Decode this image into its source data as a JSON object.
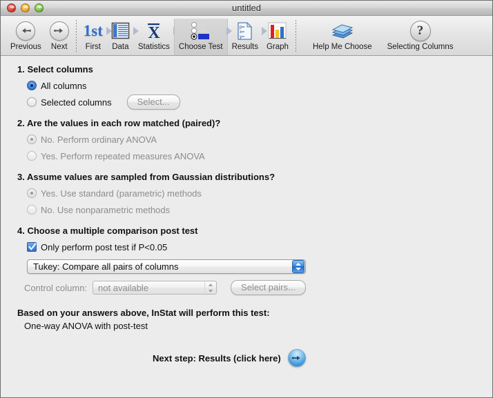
{
  "window": {
    "title": "untitled",
    "controls": [
      {
        "name": "close-button",
        "color": "#d9342a"
      },
      {
        "name": "minimize-button",
        "color": "#eba020"
      },
      {
        "name": "zoom-button",
        "color": "#71bd3a"
      }
    ]
  },
  "toolbar": {
    "items": [
      {
        "id": "previous",
        "label": "Previous",
        "icon": "arrow-left-circle-icon",
        "selected": false,
        "has_chevron": false
      },
      {
        "id": "next",
        "label": "Next",
        "icon": "arrow-right-circle-icon",
        "selected": false,
        "has_chevron": false
      },
      {
        "id": "first",
        "label": "First",
        "icon": "first-1st-icon",
        "selected": false,
        "has_chevron": true
      },
      {
        "id": "data",
        "label": "Data",
        "icon": "data-table-icon",
        "selected": false,
        "has_chevron": true
      },
      {
        "id": "statistics",
        "label": "Statistics",
        "icon": "x-bar-statistics-icon",
        "selected": false,
        "has_chevron": true
      },
      {
        "id": "choose-test",
        "label": "Choose Test",
        "icon": "choose-test-radio-icon",
        "selected": true,
        "has_chevron": true
      },
      {
        "id": "results",
        "label": "Results",
        "icon": "results-document-icon",
        "selected": false,
        "has_chevron": true
      },
      {
        "id": "graph",
        "label": "Graph",
        "icon": "bar-chart-icon",
        "selected": false,
        "has_chevron": false
      },
      {
        "id": "help-me-choose",
        "label": "Help Me Choose",
        "icon": "books-icon",
        "selected": false,
        "has_chevron": false
      },
      {
        "id": "selecting-columns",
        "label": "Selecting Columns",
        "icon": "question-mark-circle-icon",
        "selected": false,
        "has_chevron": false
      }
    ]
  },
  "sections": {
    "s1": {
      "heading": "1. Select columns",
      "options": [
        {
          "label": "All columns",
          "state": "on",
          "disabled": false
        },
        {
          "label": "Selected columns",
          "state": "off",
          "disabled": false
        }
      ],
      "select_button": "Select..."
    },
    "s2": {
      "heading": "2. Are the values in each row matched (paired)?",
      "options": [
        {
          "label": "No. Perform ordinary ANOVA",
          "state": "on",
          "disabled": true
        },
        {
          "label": "Yes. Perform repeated measures ANOVA",
          "state": "off",
          "disabled": true
        }
      ]
    },
    "s3": {
      "heading": "3. Assume values are sampled from Gaussian distributions?",
      "options": [
        {
          "label": "Yes. Use standard (parametric) methods",
          "state": "on",
          "disabled": true
        },
        {
          "label": "No. Use nonparametric methods",
          "state": "off",
          "disabled": true
        }
      ]
    },
    "s4": {
      "heading": "4. Choose a multiple comparison post test",
      "checkbox_label": "Only perform post test if P<0.05",
      "checkbox_checked": true,
      "post_test_value": "Tukey: Compare all pairs of columns",
      "control_column_label": "Control column:",
      "control_column_value": "not available",
      "select_pairs_button": "Select pairs..."
    }
  },
  "summary": {
    "heading": "Based on your answers above, InStat will perform this test:",
    "value": "One-way ANOVA with post-test"
  },
  "next_step": {
    "label": "Next step: Results (click here)",
    "icon": "arrow-right-circle-icon"
  },
  "colors": {
    "accent_blue": "#2f6fd0",
    "window_bg": "#ececec",
    "disabled_text": "#8c8c8c",
    "chevron": "#b0bdd0"
  }
}
